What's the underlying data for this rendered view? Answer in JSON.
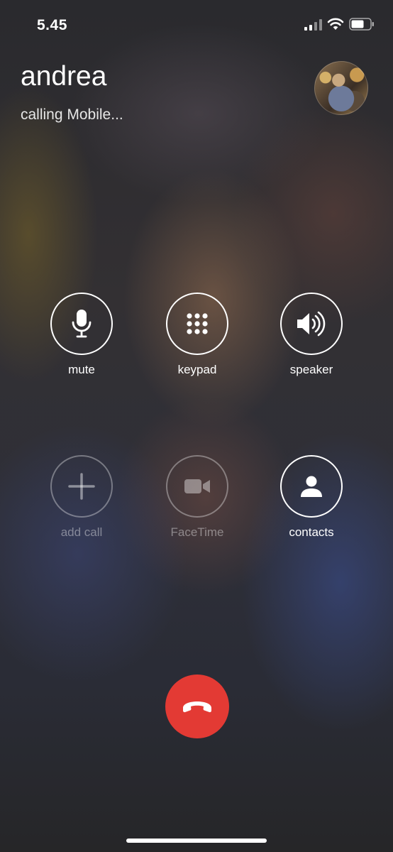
{
  "status_bar": {
    "time": "5.45"
  },
  "call": {
    "caller_name": "andrea",
    "status": "calling Mobile..."
  },
  "controls": {
    "mute": {
      "label": "mute",
      "icon": "microphone-icon"
    },
    "keypad": {
      "label": "keypad",
      "icon": "keypad-icon"
    },
    "speaker": {
      "label": "speaker",
      "icon": "speaker-icon"
    },
    "add_call": {
      "label": "add call",
      "icon": "plus-icon",
      "enabled": false
    },
    "facetime": {
      "label": "FaceTime",
      "icon": "video-camera-icon",
      "enabled": false
    },
    "contacts": {
      "label": "contacts",
      "icon": "person-icon"
    }
  },
  "end_call": {
    "icon": "hang-up-icon",
    "color": "#e33a34"
  }
}
